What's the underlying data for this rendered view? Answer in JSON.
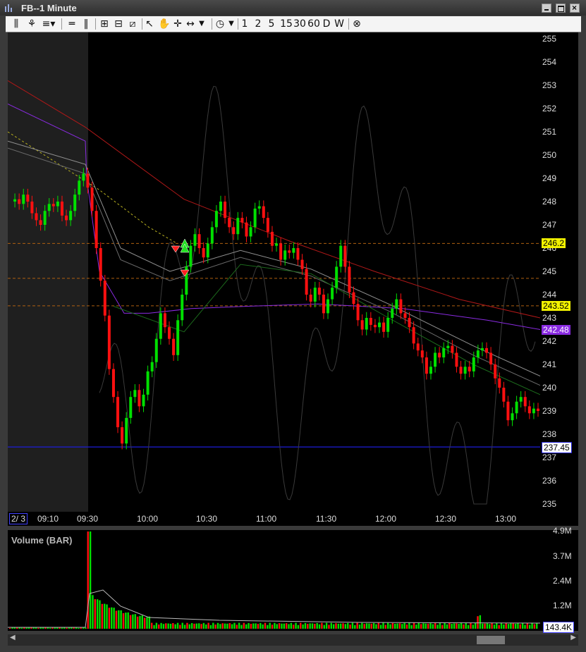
{
  "window": {
    "title": "FB--1 Minute"
  },
  "toolbar": {
    "intervals": [
      "1",
      "2",
      "5",
      "15",
      "30",
      "60",
      "D",
      "W"
    ]
  },
  "price_axis": {
    "ticks": [
      "255",
      "254",
      "253",
      "252",
      "251",
      "250",
      "249",
      "248",
      "247",
      "246",
      "245",
      "244",
      "243",
      "242",
      "241",
      "240",
      "239",
      "238",
      "237",
      "236",
      "235"
    ],
    "tags": {
      "level_upper": "246.2",
      "level_lower": "243.52",
      "ma_purple": "242.48",
      "last_price": "237.45"
    }
  },
  "time_axis": {
    "date": "2/ 3",
    "ticks": [
      "09:10",
      "09:30",
      "10:00",
      "10:30",
      "11:00",
      "11:30",
      "12:00",
      "12:30",
      "13:00"
    ]
  },
  "volume_panel": {
    "label": "Volume (BAR)",
    "ticks": [
      "4.9M",
      "3.7M",
      "2.4M",
      "1.2M"
    ],
    "last": "143.4K"
  },
  "colors": {
    "up": "#00e000",
    "down": "#ff1010",
    "purple": "#8a2be2",
    "red_ma": "#b01818",
    "level": "#b06010",
    "last_line": "#1e1ed8"
  },
  "chart_data": {
    "type": "candlestick",
    "title": "FB--1 Minute",
    "ylim": [
      234.7,
      255.5
    ],
    "x_ticks": [
      "09:10",
      "09:30",
      "10:00",
      "10:30",
      "11:00",
      "11:30",
      "12:00",
      "12:30",
      "13:00"
    ],
    "price_path": [
      248.0,
      248.1,
      247.9,
      248.3,
      248.0,
      247.5,
      247.2,
      247.0,
      247.6,
      247.9,
      247.8,
      248.0,
      247.4,
      247.2,
      247.6,
      248.3,
      248.9,
      249.2,
      248.6,
      247.6,
      246.0,
      244.6,
      243.1,
      240.8,
      239.6,
      238.3,
      237.6,
      238.7,
      239.6,
      239.9,
      239.2,
      239.7,
      240.7,
      241.1,
      242.1,
      243.2,
      242.6,
      242.1,
      241.4,
      242.9,
      244.0,
      245.2,
      246.1,
      246.6,
      246.0,
      245.6,
      246.2,
      246.9,
      247.6,
      248.0,
      247.3,
      246.9,
      246.6,
      247.3,
      247.1,
      246.5,
      246.9,
      247.7,
      247.8,
      247.3,
      246.7,
      246.1,
      246.2,
      245.5,
      245.9,
      245.8,
      246.0,
      245.5,
      245.1,
      244.0,
      243.7,
      244.3,
      244.0,
      243.2,
      243.8,
      244.3,
      245.2,
      246.1,
      245.2,
      244.1,
      243.6,
      242.9,
      242.5,
      243.0,
      242.7,
      242.6,
      242.8,
      242.4,
      243.0,
      243.4,
      243.8,
      243.2,
      243.0,
      242.6,
      241.9,
      241.6,
      241.3,
      240.6,
      240.9,
      241.5,
      241.3,
      241.7,
      241.8,
      241.5,
      240.9,
      240.6,
      240.9,
      240.7,
      241.3,
      241.6,
      241.7,
      241.5,
      241.0,
      240.4,
      240.0,
      239.4,
      238.6,
      238.9,
      239.4,
      239.6,
      239.2,
      238.9,
      239.1,
      239.0
    ],
    "volume_ylim": [
      0,
      4900000
    ]
  }
}
